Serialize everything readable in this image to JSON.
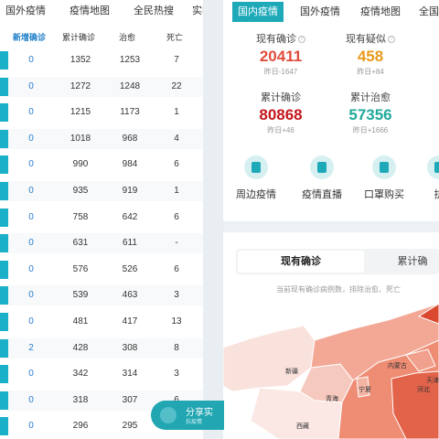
{
  "left": {
    "tabs": [
      "国外疫情",
      "疫情地图",
      "全民热搜",
      "实时"
    ],
    "columns": [
      "新增确诊",
      "累计确诊",
      "治愈",
      "死亡"
    ],
    "rows": [
      [
        "0",
        "1352",
        "1253",
        "7"
      ],
      [
        "0",
        "1272",
        "1248",
        "22"
      ],
      [
        "0",
        "1215",
        "1173",
        "1"
      ],
      [
        "0",
        "1018",
        "968",
        "4"
      ],
      [
        "0",
        "990",
        "984",
        "6"
      ],
      [
        "0",
        "935",
        "919",
        "1"
      ],
      [
        "0",
        "758",
        "642",
        "6"
      ],
      [
        "0",
        "631",
        "611",
        "-"
      ],
      [
        "0",
        "576",
        "526",
        "6"
      ],
      [
        "0",
        "539",
        "463",
        "3"
      ],
      [
        "0",
        "481",
        "417",
        "13"
      ],
      [
        "2",
        "428",
        "308",
        "8"
      ],
      [
        "0",
        "342",
        "314",
        "3"
      ],
      [
        "0",
        "318",
        "307",
        "6"
      ],
      [
        "0",
        "296",
        "295",
        "1"
      ]
    ],
    "accent": "#1ab0c8"
  },
  "right": {
    "tabs": [
      "国内疫情",
      "国外疫情",
      "疫情地图",
      "全国"
    ],
    "stats": [
      {
        "label": "现有确诊",
        "value": "20411",
        "delta": "昨日-1647",
        "color": "#e04d3c"
      },
      {
        "label": "现有疑似",
        "value": "458",
        "delta": "昨日+84",
        "color": "#e89a1b"
      },
      {
        "label": "累计确诊",
        "value": "80868",
        "delta": "昨日+46",
        "color": "#c4161c"
      },
      {
        "label": "累计治愈",
        "value": "57356",
        "delta": "昨日+1666",
        "color": "#1fa99a"
      }
    ],
    "services": [
      "周边疫情",
      "疫情直播",
      "口罩购买",
      "抗"
    ],
    "switch": {
      "active": "现有确诊",
      "other": "累计确"
    },
    "note": "当前现有确诊病例数，排除治愈、死亡",
    "map_labels": [
      "新疆",
      "青海",
      "西藏",
      "内蒙古",
      "河北",
      "天津",
      "宁夏"
    ],
    "share": {
      "title": "分享实",
      "sub": "抗疫情"
    },
    "accent": "#1ea9b9"
  }
}
